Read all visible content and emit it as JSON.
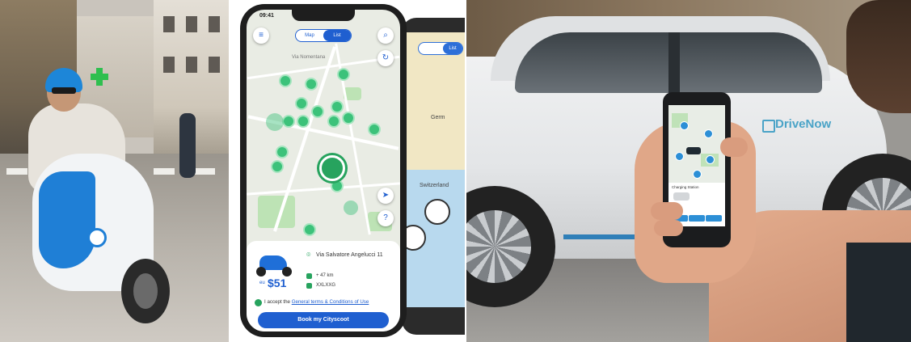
{
  "panel_scooter_photo": {
    "description_icon": "scooter-rider-photo"
  },
  "app_screen": {
    "status_time": "09:41",
    "map_toggle": {
      "option_1": "Map",
      "option_2": "List",
      "selected": "List"
    },
    "street_label": "Via Nomentana",
    "vehicle": {
      "price_prefix": "eu",
      "price": "$51",
      "address": "Via Salvatore Angelucci 11",
      "range": "+ 47 km",
      "plate": "XXLXXG"
    },
    "terms": {
      "prefix": "I accept the ",
      "link": "General terms & Conditions of Use"
    },
    "book_button": "Book my Cityscoot"
  },
  "back_phone": {
    "toggle_label": "List",
    "labels": [
      "Germ",
      "Switzerland"
    ]
  },
  "car_photo": {
    "brand_text": "DriveNow",
    "phone_screen_title": "Charging Station"
  },
  "colors": {
    "accent_blue": "#1f5fd0",
    "pin_green": "#3cc27a",
    "scooter_blue": "#1f7fd6",
    "brand_teal": "#4aa3c7"
  }
}
